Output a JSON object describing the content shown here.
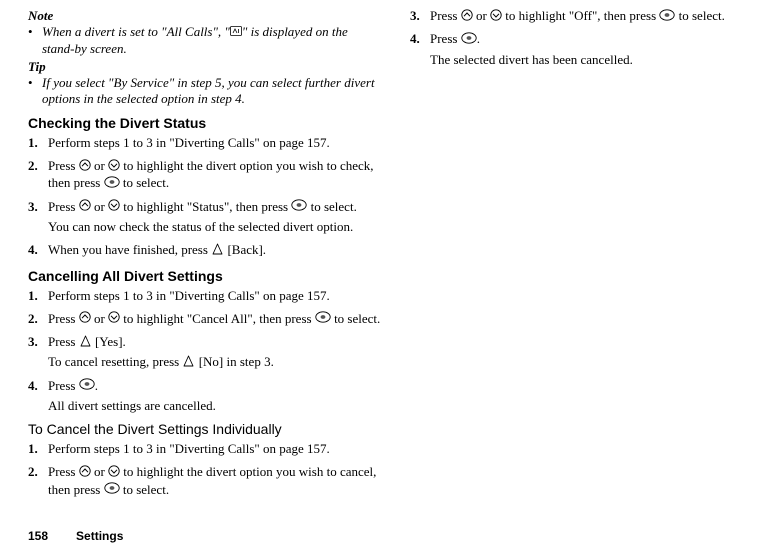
{
  "note": {
    "head": "Note",
    "bullet": "When a divert is set to \"All Calls\", \"",
    "bullet_tail": "\" is displayed on the stand-by screen."
  },
  "tip": {
    "head": "Tip",
    "bullet": "If you select \"By Service\" in step 5, you can select further divert options in the selected option in step 4."
  },
  "checking": {
    "head": "Checking the Divert Status",
    "s1": "Perform steps 1 to 3 in \"Diverting Calls\" on page 157.",
    "s2a": "Press ",
    "s2b": " or ",
    "s2c": " to highlight the divert option you wish to check, then press ",
    "s2d": " to select.",
    "s3a": "Press ",
    "s3b": " or ",
    "s3c": " to highlight \"Status\", then press ",
    "s3d": " to select.",
    "s3note": "You can now check the status of the selected divert option.",
    "s4a": "When you have finished, press ",
    "s4b": " [Back]."
  },
  "cancel_all": {
    "head": "Cancelling All Divert Settings",
    "s1": "Perform steps 1 to 3 in \"Diverting Calls\" on page 157.",
    "s2a": "Press ",
    "s2b": " or ",
    "s2c": " to highlight \"Cancel All\", then press ",
    "s2d": " to select.",
    "s3a": "Press ",
    "s3b": " [Yes].",
    "s3note_a": "To cancel resetting, press ",
    "s3note_b": " [No] in step 3.",
    "s4a": "Press ",
    "s4b": ".",
    "s4note": "All divert settings are cancelled."
  },
  "cancel_ind": {
    "head": "To Cancel the Divert Settings Individually",
    "s1": "Perform steps 1 to 3 in \"Diverting Calls\" on page 157.",
    "s2a": "Press ",
    "s2b": " or ",
    "s2c": " to highlight the divert option you wish to cancel, then press ",
    "s2d": " to select.",
    "s3a": "Press ",
    "s3b": " or ",
    "s3c": " to highlight \"Off\", then press ",
    "s3d": " to select.",
    "s4a": "Press ",
    "s4b": ".",
    "s4note": "The selected divert has been cancelled."
  },
  "footer": {
    "page": "158",
    "label": "Settings"
  },
  "nums": {
    "n1": "1.",
    "n2": "2.",
    "n3": "3.",
    "n4": "4."
  },
  "bullet_char": "•"
}
